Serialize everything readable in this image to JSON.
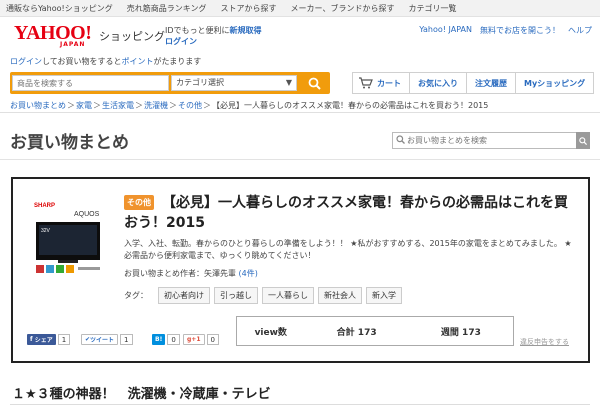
{
  "topnav": {
    "items": [
      "通販ならYahoo!ショッピング",
      "売れ筋商品ランキング",
      "ストアから探す",
      "メーカー、ブランドから探す",
      "カテゴリ一覧"
    ]
  },
  "header": {
    "logo": "YAHOO!",
    "logo_sub": "JAPAN",
    "shop": "ショッピング",
    "idline_pre": "IDでもっと便利に",
    "register": "新規取得",
    "login": "ログイン",
    "right_links": [
      "Yahoo! JAPAN",
      "無料でお店を開こう！",
      "ヘルプ"
    ],
    "point_login": "ログイン",
    "point_mid": "してお買い物をすると",
    "point_link": "ポイント",
    "point_post": "がたまります"
  },
  "search": {
    "placeholder": "商品を検索する",
    "category": "カテゴリ選択",
    "accent": "#f19c0c"
  },
  "nav": {
    "cart": "カート",
    "favorites": "お気に入り",
    "history": "注文履歴",
    "my": "Myショッピング"
  },
  "breadcrumb": {
    "items": [
      "お買い物まとめ",
      "家電",
      "生活家電",
      "洗濯機",
      "その他"
    ],
    "current": "【必見】一人暮らしのオススメ家電！春からの必需品はこれを買おう！2015"
  },
  "page": {
    "title": "お買い物まとめ",
    "search_placeholder": "お買い物まとめを検索"
  },
  "article": {
    "badge": "その他",
    "title": "【必見】一人暮らしのオススメ家電！春からの必需品はこれを買おう！2015",
    "desc": "入学、入社、転勤。春からのひとり暮らしの準備をしよう！！ ★私がおすすめする、2015年の家電をまとめてみました。 ★必需品から便利家電まで、ゆっくり眺めてください！",
    "author_label": "お買い物まとめ作者：",
    "author": "矢澤先輩",
    "author_count": "(4件)",
    "tags_label": "タグ：",
    "tags": [
      "初心者向け",
      "引っ越し",
      "一人暮らし",
      "新社会人",
      "新入学"
    ],
    "thumb_brand": "SHARP",
    "thumb_model": "AQUOS",
    "thumb_size": "32V"
  },
  "social": {
    "fb_label": "シェア",
    "fb_count": "1",
    "tw_label": "ツイート",
    "tw_count": "1",
    "hb_label": "B!",
    "hb_count": "0",
    "gp_label": "g+1",
    "gp_count": "0"
  },
  "views": {
    "label": "view数",
    "total": "合計 173",
    "weekly": "週間 173"
  },
  "report": "違反申告をする",
  "section": {
    "heading": "１★３種の神器！　洗濯機・冷蔵庫・テレビ"
  }
}
